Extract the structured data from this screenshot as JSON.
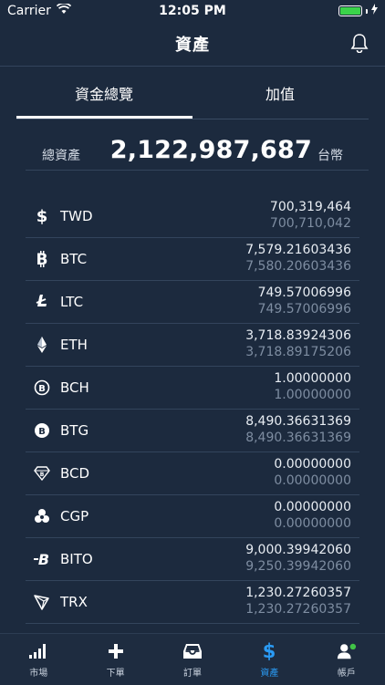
{
  "status": {
    "carrier": "Carrier",
    "time": "12:05 PM"
  },
  "header": {
    "title": "資產"
  },
  "tabs": [
    {
      "label": "資金總覽"
    },
    {
      "label": "加值"
    }
  ],
  "total": {
    "label": "總資產",
    "amount": "2,122,987,687",
    "unit": "台幣"
  },
  "assets": [
    {
      "symbol": "TWD",
      "icon": "dollar-icon",
      "value": "700,319,464",
      "sub": "700,710,042"
    },
    {
      "symbol": "BTC",
      "icon": "bitcoin-icon",
      "value": "7,579.21603436",
      "sub": "7,580.20603436"
    },
    {
      "symbol": "LTC",
      "icon": "litecoin-icon",
      "value": "749.57006996",
      "sub": "749.57006996"
    },
    {
      "symbol": "ETH",
      "icon": "ethereum-icon",
      "value": "3,718.83924306",
      "sub": "3,718.89175206"
    },
    {
      "symbol": "BCH",
      "icon": "bitcoin-cash-icon",
      "value": "1.00000000",
      "sub": "1.00000000"
    },
    {
      "symbol": "BTG",
      "icon": "bitcoin-gold-icon",
      "value": "8,490.36631369",
      "sub": "8,490.36631369"
    },
    {
      "symbol": "BCD",
      "icon": "bitcoin-diamond-icon",
      "value": "0.00000000",
      "sub": "0.00000000"
    },
    {
      "symbol": "CGP",
      "icon": "cgp-icon",
      "value": "0.00000000",
      "sub": "0.00000000"
    },
    {
      "symbol": "BITO",
      "icon": "bito-icon",
      "value": "9,000.39942060",
      "sub": "9,250.39942060"
    },
    {
      "symbol": "TRX",
      "icon": "tron-icon",
      "value": "1,230.27260357",
      "sub": "1,230.27260357"
    }
  ],
  "tabbar": [
    {
      "label": "市場",
      "icon": "market-bars-icon"
    },
    {
      "label": "下單",
      "icon": "plus-icon"
    },
    {
      "label": "訂單",
      "icon": "inbox-icon"
    },
    {
      "label": "資產",
      "icon": "dollar-icon"
    },
    {
      "label": "帳戶",
      "icon": "user-icon"
    }
  ],
  "colors": {
    "background": "#1c2a3e",
    "active": "#2a9bf5",
    "battery": "#3ad34a",
    "online_dot": "#41c447"
  }
}
